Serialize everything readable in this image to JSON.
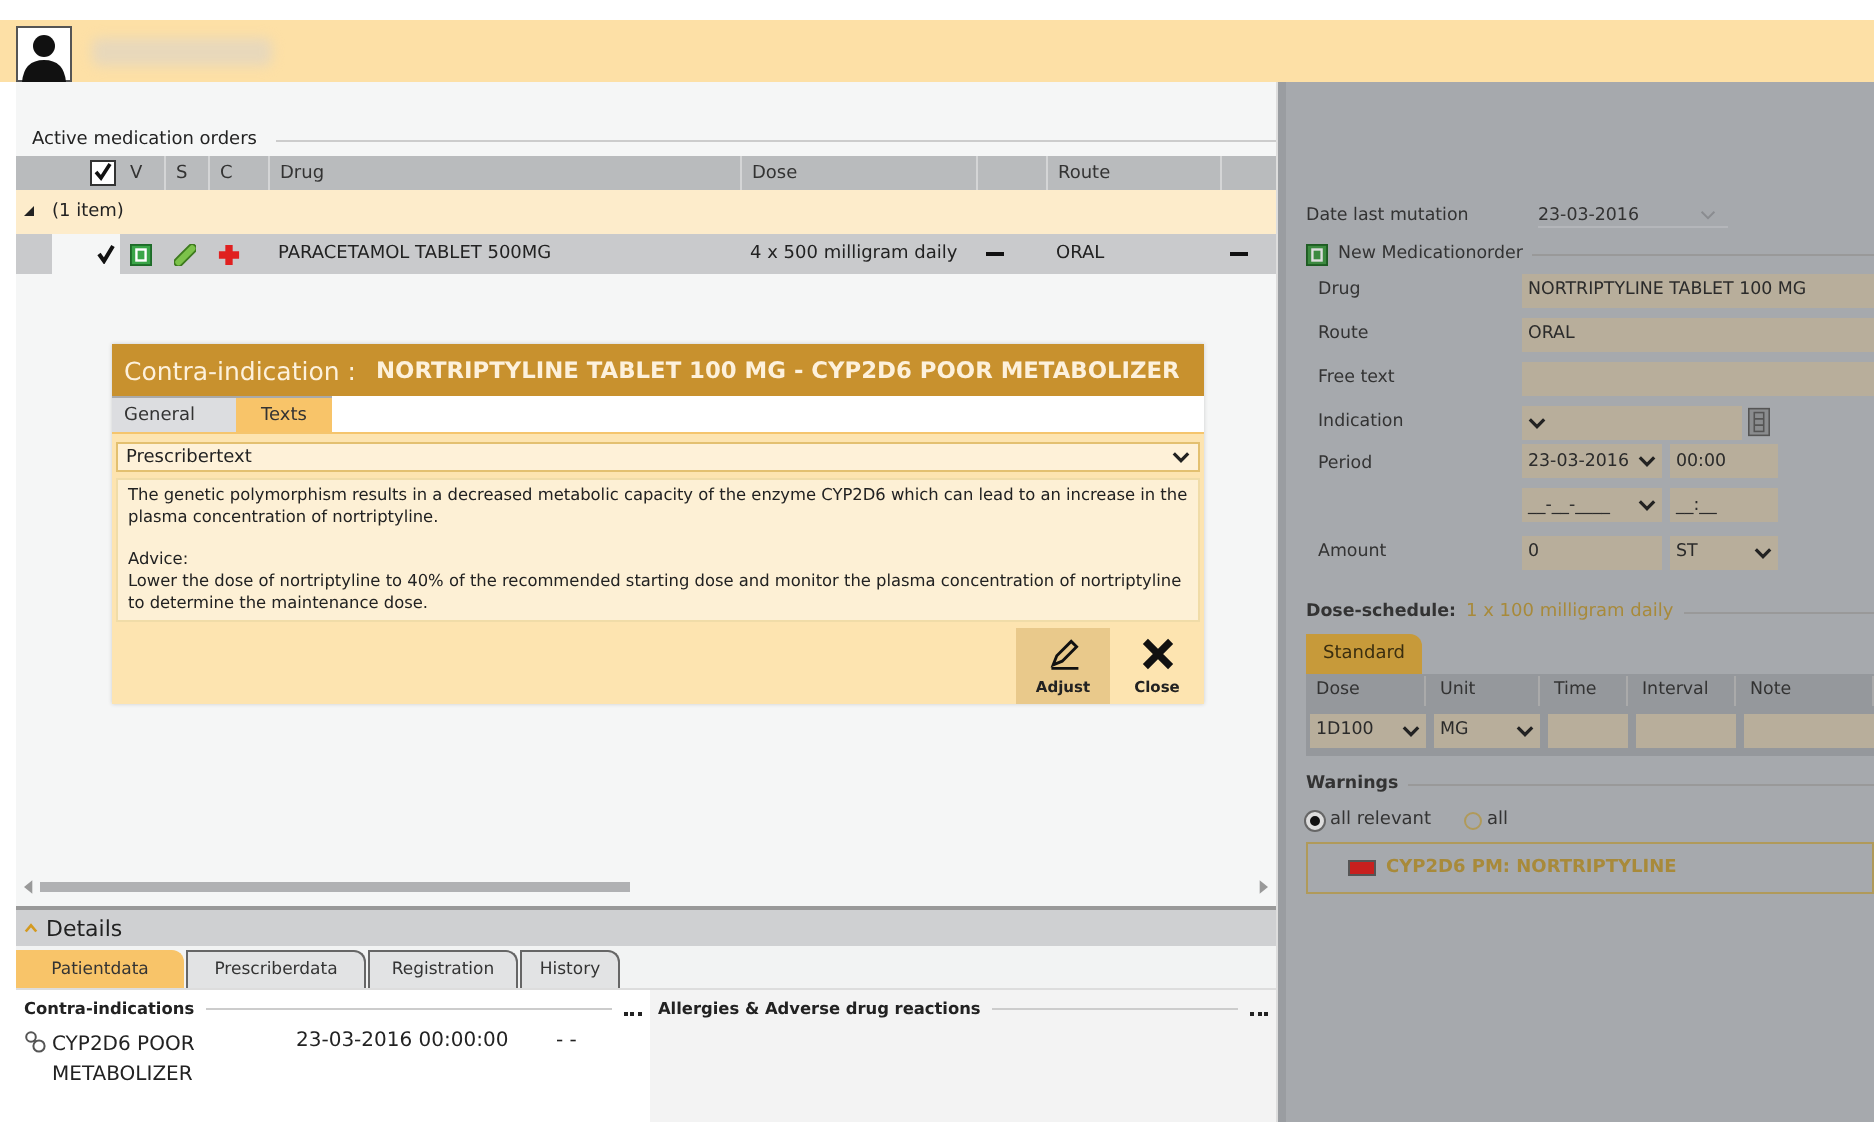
{
  "orders": {
    "title": "Active medication orders",
    "select_all_checked": true,
    "columns": [
      "V",
      "S",
      "C",
      "Drug",
      "Dose",
      "",
      "Route",
      ""
    ],
    "group": {
      "label": "(1 item)",
      "expanded": true
    },
    "rows": [
      {
        "checked": true,
        "drug": "PARACETAMOL TABLET  500MG",
        "dose": "4 x 500 milligram daily",
        "route": "ORAL"
      }
    ]
  },
  "dialog": {
    "label": "Contra-indication :",
    "title": "NORTRIPTYLINE TABLET 100 MG  -  CYP2D6 POOR METABOLIZER",
    "tabs": [
      {
        "label": "General",
        "selected": false
      },
      {
        "label": "Texts",
        "selected": true
      }
    ],
    "text_type": "Prescribertext",
    "paragraphs": [
      "The genetic polymorphism results in a decreased metabolic capacity of the enzyme CYP2D6 which can lead to an increase in the plasma concentration of nortriptyline.",
      "Advice:\nLower the dose of nortriptyline to 40% of the recommended starting dose and monitor the plasma concentration of nortriptyline to determine the maintenance dose."
    ],
    "buttons": [
      {
        "label": "Adjust",
        "kind": "edit"
      },
      {
        "label": "Close",
        "kind": "close"
      }
    ]
  },
  "order_form": {
    "date_label": "Date last mutation",
    "date_value": "23-03-2016",
    "section": "New Medicationorder",
    "fields": [
      {
        "kind": "text",
        "label": "Drug",
        "value": "NORTRIPTYLINE TABLET 100  MG"
      },
      {
        "kind": "text",
        "label": "Route",
        "value": "ORAL"
      },
      {
        "kind": "text",
        "label": "Free text"
      },
      {
        "kind": "indication",
        "label": "Indication"
      },
      {
        "kind": "period",
        "label": "Period",
        "value": "23-03-2016",
        "time": "00:00",
        "end_date": "__-__-____",
        "end_time": "__:__"
      },
      {
        "kind": "amount",
        "label": "Amount",
        "value": "0",
        "unit": "ST"
      }
    ]
  },
  "dose_schedule": {
    "label": "Dose-schedule:",
    "summary": "1 x 100 milligram daily",
    "tab": "Standard",
    "columns": [
      "Dose",
      "Unit",
      "Time",
      "Interval",
      "Note"
    ],
    "dose": "1D100",
    "unit": "MG"
  },
  "warnings": {
    "title": "Warnings",
    "filters": [
      {
        "label": "all relevant",
        "selected": true
      },
      {
        "label": "all",
        "selected": false
      }
    ],
    "items": [
      {
        "text": "CYP2D6 PM: NORTRIPTYLINE",
        "color": "#c8201e"
      }
    ]
  },
  "details": {
    "title": "Details",
    "expanded": true,
    "tabs": [
      {
        "label": "Patientdata",
        "selected": true
      },
      {
        "label": "Prescriberdata",
        "selected": false
      },
      {
        "label": "Registration",
        "selected": false
      },
      {
        "label": "History",
        "selected": false
      }
    ],
    "contra_title": "Contra-indications",
    "contra": [
      {
        "name": "CYP2D6 POOR\nMETABOLIZER",
        "date": "23-03-2016 00:00:00",
        "column_3": "-  -"
      }
    ],
    "allergies_title": "Allergies & Adverse drug reactions"
  }
}
